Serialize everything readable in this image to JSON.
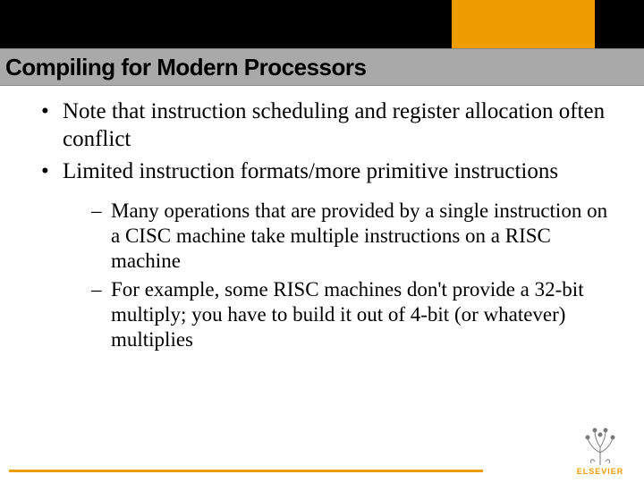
{
  "header": {
    "title": "Compiling for Modern Processors"
  },
  "bullets": [
    {
      "text": "Note that instruction scheduling and register allocation often conflict"
    },
    {
      "text": "Limited instruction formats/more primitive instructions",
      "sub": [
        {
          "text": "Many operations that are provided by a single instruction on a CISC machine take multiple instructions on a RISC machine"
        },
        {
          "text": "For example, some RISC machines don't provide a 32-bit multiply; you have to build it out of 4-bit (or whatever) multiplies"
        }
      ]
    }
  ],
  "footer": {
    "brand": "ELSEVIER"
  }
}
